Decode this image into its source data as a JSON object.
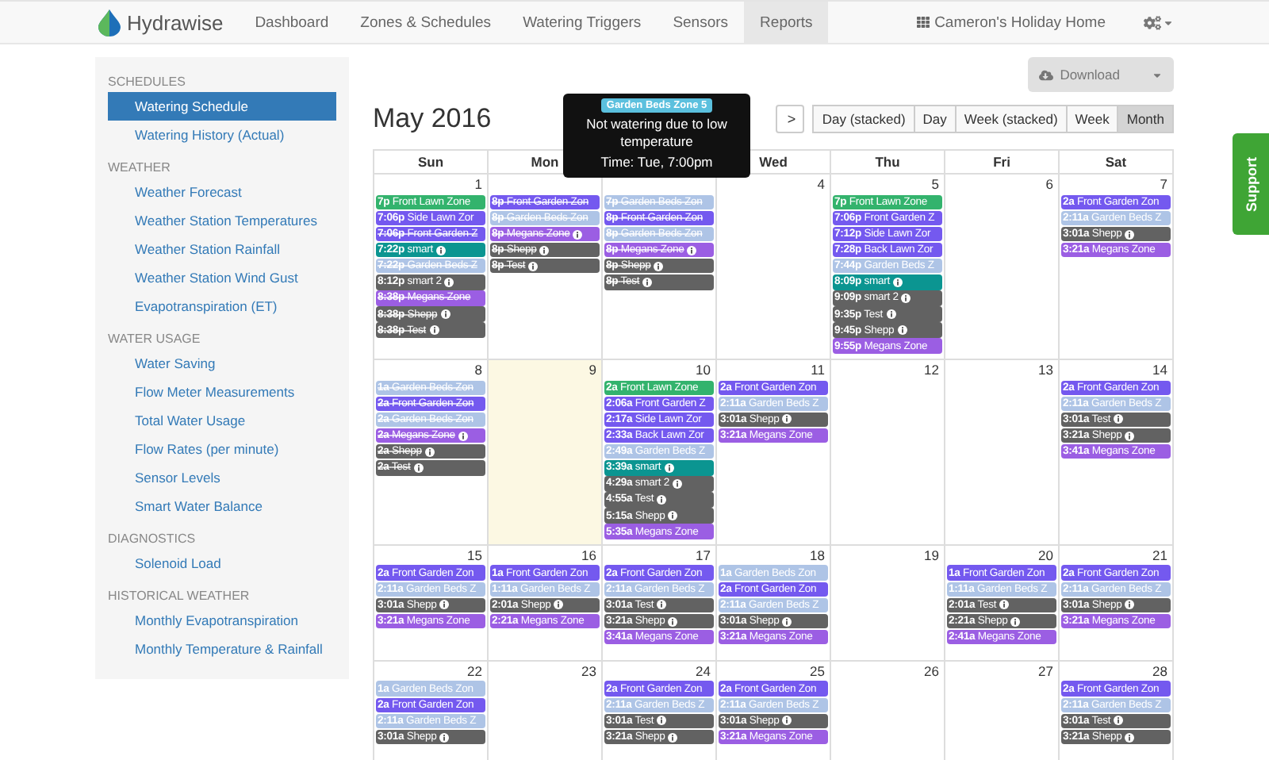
{
  "app": {
    "brand": "Hydrawise",
    "account": "Cameron's Holiday Home",
    "nav": [
      {
        "label": "Dashboard",
        "selected": false
      },
      {
        "label": "Zones & Schedules",
        "selected": false
      },
      {
        "label": "Watering Triggers",
        "selected": false
      },
      {
        "label": "Sensors",
        "selected": false
      },
      {
        "label": "Reports",
        "selected": true
      }
    ]
  },
  "sidebar": {
    "sections": [
      {
        "heading": "SCHEDULES",
        "items": [
          {
            "label": "Watering Schedule",
            "selected": true
          },
          {
            "label": "Watering History (Actual)",
            "selected": false
          }
        ]
      },
      {
        "heading": "WEATHER",
        "items": [
          {
            "label": "Weather Forecast",
            "selected": false
          },
          {
            "label": "Weather Station Temperatures",
            "selected": false
          },
          {
            "label": "Weather Station Rainfall",
            "selected": false
          },
          {
            "label": "Weather Station Wind Gust",
            "selected": false
          },
          {
            "label": "Evapotranspiration (ET)",
            "selected": false
          }
        ]
      },
      {
        "heading": "WATER USAGE",
        "items": [
          {
            "label": "Water Saving",
            "selected": false
          },
          {
            "label": "Flow Meter Measurements",
            "selected": false
          },
          {
            "label": "Total Water Usage",
            "selected": false
          },
          {
            "label": "Flow Rates (per minute)",
            "selected": false
          },
          {
            "label": "Sensor Levels",
            "selected": false
          },
          {
            "label": "Smart Water Balance",
            "selected": false
          }
        ]
      },
      {
        "heading": "DIAGNOSTICS",
        "items": [
          {
            "label": "Solenoid Load",
            "selected": false
          }
        ]
      },
      {
        "heading": "HISTORICAL WEATHER",
        "items": [
          {
            "label": "Monthly Evapotranspiration",
            "selected": false
          },
          {
            "label": "Monthly Temperature & Rainfall",
            "selected": false
          }
        ]
      }
    ]
  },
  "toolbar": {
    "download": "Download",
    "title": "May 2016",
    "next": ">",
    "views": [
      {
        "label": "Day (stacked)",
        "selected": false
      },
      {
        "label": "Day",
        "selected": false
      },
      {
        "label": "Week (stacked)",
        "selected": false
      },
      {
        "label": "Week",
        "selected": false
      },
      {
        "label": "Month",
        "selected": true
      }
    ]
  },
  "tooltip": {
    "badge": "Garden Beds Zone 5",
    "message": "Not watering due to low temperature",
    "time": "Time: Tue, 7:00pm"
  },
  "support": "Support",
  "calendar": {
    "weekdays": [
      "Sun",
      "Mon",
      "Wed",
      "Thu",
      "Fri",
      "Sat"
    ],
    "weeks": [
      {
        "days": [
          {
            "number": "1",
            "today": false,
            "events": [
              {
                "time": "7p",
                "zone": "Front Lawn Zone",
                "color": "#33b36d",
                "struck": false,
                "info": false
              },
              {
                "time": "7:06p",
                "zone": "Side Lawn Zor",
                "color": "#7459ef",
                "struck": false,
                "info": false
              },
              {
                "time": "7:06p",
                "zone": "Front Garden Z",
                "color": "#7459ef",
                "struck": true,
                "info": false
              },
              {
                "time": "7:22p",
                "zone": "smart",
                "color": "#0b9591",
                "struck": false,
                "info": true
              },
              {
                "time": "7:22p",
                "zone": "Garden Beds Z",
                "color": "#aec4e6",
                "struck": true,
                "info": false
              },
              {
                "time": "8:12p",
                "zone": "smart 2",
                "color": "#626262",
                "struck": false,
                "info": true
              },
              {
                "time": "8:38p",
                "zone": "Megans Zone",
                "color": "#9b5ee3",
                "struck": true,
                "info": false
              },
              {
                "time": "8:38p",
                "zone": "Shepp",
                "color": "#626262",
                "struck": true,
                "info": true
              },
              {
                "time": "8:38p",
                "zone": "Test",
                "color": "#626262",
                "struck": true,
                "info": true
              }
            ]
          },
          {
            "today": false,
            "events": [
              {
                "time": "8p",
                "zone": "Front Garden Zon",
                "color": "#7459ef",
                "struck": true,
                "info": false
              },
              {
                "time": "8p",
                "zone": "Garden Beds Zon",
                "color": "#aec4e6",
                "struck": true,
                "info": false
              },
              {
                "time": "8p",
                "zone": "Megans Zone",
                "color": "#9b5ee3",
                "struck": true,
                "info": true
              },
              {
                "time": "8p",
                "zone": "Shepp",
                "color": "#626262",
                "struck": true,
                "info": true
              },
              {
                "time": "8p",
                "zone": "Test",
                "color": "#626262",
                "struck": true,
                "info": true
              }
            ]
          },
          {
            "today": false,
            "events": [
              {
                "time": "7p",
                "zone": "Garden Beds Zon",
                "color": "#aec4e6",
                "struck": true,
                "info": false
              },
              {
                "time": "8p",
                "zone": "Front Garden Zon",
                "color": "#7459ef",
                "struck": true,
                "info": false
              },
              {
                "time": "8p",
                "zone": "Garden Beds Zon",
                "color": "#aec4e6",
                "struck": true,
                "info": false
              },
              {
                "time": "8p",
                "zone": "Megans Zone",
                "color": "#9b5ee3",
                "struck": true,
                "info": true
              },
              {
                "time": "8p",
                "zone": "Shepp",
                "color": "#626262",
                "struck": true,
                "info": true
              },
              {
                "time": "8p",
                "zone": "Test",
                "color": "#626262",
                "struck": true,
                "info": true
              }
            ]
          },
          {
            "number": "4",
            "today": false
          },
          {
            "number": "5",
            "today": false,
            "events": [
              {
                "time": "7p",
                "zone": "Front Lawn Zone",
                "color": "#33b36d",
                "struck": false,
                "info": false
              },
              {
                "time": "7:06p",
                "zone": "Front Garden Z",
                "color": "#7459ef",
                "struck": false,
                "info": false
              },
              {
                "time": "7:12p",
                "zone": "Side Lawn Zor",
                "color": "#7459ef",
                "struck": false,
                "info": false
              },
              {
                "time": "7:28p",
                "zone": "Back Lawn Zor",
                "color": "#7459ef",
                "struck": false,
                "info": false
              },
              {
                "time": "7:44p",
                "zone": "Garden Beds Z",
                "color": "#aec4e6",
                "struck": false,
                "info": false
              },
              {
                "time": "8:09p",
                "zone": "smart",
                "color": "#0b9591",
                "struck": false,
                "info": true
              },
              {
                "time": "9:09p",
                "zone": "smart 2",
                "color": "#626262",
                "struck": false,
                "info": true
              },
              {
                "time": "9:35p",
                "zone": "Test",
                "color": "#626262",
                "struck": false,
                "info": true
              },
              {
                "time": "9:45p",
                "zone": "Shepp",
                "color": "#626262",
                "struck": false,
                "info": true
              },
              {
                "time": "9:55p",
                "zone": "Megans Zone",
                "color": "#9b5ee3",
                "struck": false,
                "info": false
              }
            ]
          },
          {
            "number": "6",
            "today": false
          },
          {
            "number": "7",
            "today": false,
            "events": [
              {
                "time": "2a",
                "zone": "Front Garden Zon",
                "color": "#7459ef",
                "struck": false,
                "info": false
              },
              {
                "time": "2:11a",
                "zone": "Garden Beds Z",
                "color": "#aec4e6",
                "struck": false,
                "info": false
              },
              {
                "time": "3:01a",
                "zone": "Shepp",
                "color": "#626262",
                "struck": false,
                "info": true
              },
              {
                "time": "3:21a",
                "zone": "Megans Zone",
                "color": "#9b5ee3",
                "struck": false,
                "info": false
              }
            ]
          }
        ]
      },
      {
        "days": [
          {
            "number": "8",
            "today": false,
            "events": [
              {
                "time": "1a",
                "zone": "Garden Beds Zon",
                "color": "#aec4e6",
                "struck": true,
                "info": false
              },
              {
                "time": "2a",
                "zone": "Front Garden Zon",
                "color": "#7459ef",
                "struck": true,
                "info": false
              },
              {
                "time": "2a",
                "zone": "Garden Beds Zon",
                "color": "#aec4e6",
                "struck": true,
                "info": false
              },
              {
                "time": "2a",
                "zone": "Megans Zone",
                "color": "#9b5ee3",
                "struck": true,
                "info": true
              },
              {
                "time": "2a",
                "zone": "Shepp",
                "color": "#626262",
                "struck": true,
                "info": true
              },
              {
                "time": "2a",
                "zone": "Test",
                "color": "#626262",
                "struck": true,
                "info": true
              }
            ]
          },
          {
            "number": "9",
            "today": true
          },
          {
            "number": "10",
            "today": false,
            "events": [
              {
                "time": "2a",
                "zone": "Front Lawn Zone",
                "color": "#33b36d",
                "struck": false,
                "info": false
              },
              {
                "time": "2:06a",
                "zone": "Front Garden Z",
                "color": "#7459ef",
                "struck": false,
                "info": false
              },
              {
                "time": "2:17a",
                "zone": "Side Lawn Zor",
                "color": "#7459ef",
                "struck": false,
                "info": false
              },
              {
                "time": "2:33a",
                "zone": "Back Lawn Zor",
                "color": "#7459ef",
                "struck": false,
                "info": false
              },
              {
                "time": "2:49a",
                "zone": "Garden Beds Z",
                "color": "#aec4e6",
                "struck": false,
                "info": false
              },
              {
                "time": "3:39a",
                "zone": "smart",
                "color": "#0b9591",
                "struck": false,
                "info": true
              },
              {
                "time": "4:29a",
                "zone": "smart 2",
                "color": "#626262",
                "struck": false,
                "info": true
              },
              {
                "time": "4:55a",
                "zone": "Test",
                "color": "#626262",
                "struck": false,
                "info": true
              },
              {
                "time": "5:15a",
                "zone": "Shepp",
                "color": "#626262",
                "struck": false,
                "info": true
              },
              {
                "time": "5:35a",
                "zone": "Megans Zone",
                "color": "#9b5ee3",
                "struck": false,
                "info": false
              }
            ]
          },
          {
            "number": "11",
            "today": false,
            "events": [
              {
                "time": "2a",
                "zone": "Front Garden Zon",
                "color": "#7459ef",
                "struck": false,
                "info": false
              },
              {
                "time": "2:11a",
                "zone": "Garden Beds Z",
                "color": "#aec4e6",
                "struck": false,
                "info": false
              },
              {
                "time": "3:01a",
                "zone": "Shepp",
                "color": "#626262",
                "struck": false,
                "info": true
              },
              {
                "time": "3:21a",
                "zone": "Megans Zone",
                "color": "#9b5ee3",
                "struck": false,
                "info": false
              }
            ]
          },
          {
            "number": "12",
            "today": false
          },
          {
            "number": "13",
            "today": false
          },
          {
            "number": "14",
            "today": false,
            "events": [
              {
                "time": "2a",
                "zone": "Front Garden Zon",
                "color": "#7459ef",
                "struck": false,
                "info": false
              },
              {
                "time": "2:11a",
                "zone": "Garden Beds Z",
                "color": "#aec4e6",
                "struck": false,
                "info": false
              },
              {
                "time": "3:01a",
                "zone": "Test",
                "color": "#626262",
                "struck": false,
                "info": true
              },
              {
                "time": "3:21a",
                "zone": "Shepp",
                "color": "#626262",
                "struck": false,
                "info": true
              },
              {
                "time": "3:41a",
                "zone": "Megans Zone",
                "color": "#9b5ee3",
                "struck": false,
                "info": false
              }
            ]
          }
        ]
      },
      {
        "days": [
          {
            "number": "15",
            "today": false,
            "events": [
              {
                "time": "2a",
                "zone": "Front Garden Zon",
                "color": "#7459ef",
                "struck": false,
                "info": false
              },
              {
                "time": "2:11a",
                "zone": "Garden Beds Z",
                "color": "#aec4e6",
                "struck": false,
                "info": false
              },
              {
                "time": "3:01a",
                "zone": "Shepp",
                "color": "#626262",
                "struck": false,
                "info": true
              },
              {
                "time": "3:21a",
                "zone": "Megans Zone",
                "color": "#9b5ee3",
                "struck": false,
                "info": false
              }
            ]
          },
          {
            "number": "16",
            "today": false,
            "events": [
              {
                "time": "1a",
                "zone": "Front Garden Zon",
                "color": "#7459ef",
                "struck": false,
                "info": false
              },
              {
                "time": "1:11a",
                "zone": "Garden Beds Z",
                "color": "#aec4e6",
                "struck": false,
                "info": false
              },
              {
                "time": "2:01a",
                "zone": "Shepp",
                "color": "#626262",
                "struck": false,
                "info": true
              },
              {
                "time": "2:21a",
                "zone": "Megans Zone",
                "color": "#9b5ee3",
                "struck": false,
                "info": false
              }
            ]
          },
          {
            "number": "17",
            "today": false,
            "events": [
              {
                "time": "2a",
                "zone": "Front Garden Zon",
                "color": "#7459ef",
                "struck": false,
                "info": false
              },
              {
                "time": "2:11a",
                "zone": "Garden Beds Z",
                "color": "#aec4e6",
                "struck": false,
                "info": false
              },
              {
                "time": "3:01a",
                "zone": "Test",
                "color": "#626262",
                "struck": false,
                "info": true
              },
              {
                "time": "3:21a",
                "zone": "Shepp",
                "color": "#626262",
                "struck": false,
                "info": true
              },
              {
                "time": "3:41a",
                "zone": "Megans Zone",
                "color": "#9b5ee3",
                "struck": false,
                "info": false
              }
            ]
          },
          {
            "number": "18",
            "today": false,
            "events": [
              {
                "time": "1a",
                "zone": "Garden Beds Zon",
                "color": "#aec4e6",
                "struck": false,
                "info": false
              },
              {
                "time": "2a",
                "zone": "Front Garden Zon",
                "color": "#7459ef",
                "struck": false,
                "info": false
              },
              {
                "time": "2:11a",
                "zone": "Garden Beds Z",
                "color": "#aec4e6",
                "struck": false,
                "info": false
              },
              {
                "time": "3:01a",
                "zone": "Shepp",
                "color": "#626262",
                "struck": false,
                "info": true
              },
              {
                "time": "3:21a",
                "zone": "Megans Zone",
                "color": "#9b5ee3",
                "struck": false,
                "info": false
              }
            ]
          },
          {
            "number": "19",
            "today": false
          },
          {
            "number": "20",
            "today": false,
            "events": [
              {
                "time": "1a",
                "zone": "Front Garden Zon",
                "color": "#7459ef",
                "struck": false,
                "info": false
              },
              {
                "time": "1:11a",
                "zone": "Garden Beds Z",
                "color": "#aec4e6",
                "struck": false,
                "info": false
              },
              {
                "time": "2:01a",
                "zone": "Test",
                "color": "#626262",
                "struck": false,
                "info": true
              },
              {
                "time": "2:21a",
                "zone": "Shepp",
                "color": "#626262",
                "struck": false,
                "info": true
              },
              {
                "time": "2:41a",
                "zone": "Megans Zone",
                "color": "#9b5ee3",
                "struck": false,
                "info": false
              }
            ]
          },
          {
            "number": "21",
            "today": false,
            "events": [
              {
                "time": "2a",
                "zone": "Front Garden Zon",
                "color": "#7459ef",
                "struck": false,
                "info": false
              },
              {
                "time": "2:11a",
                "zone": "Garden Beds Z",
                "color": "#aec4e6",
                "struck": false,
                "info": false
              },
              {
                "time": "3:01a",
                "zone": "Shepp",
                "color": "#626262",
                "struck": false,
                "info": true
              },
              {
                "time": "3:21a",
                "zone": "Megans Zone",
                "color": "#9b5ee3",
                "struck": false,
                "info": false
              }
            ]
          }
        ]
      },
      {
        "days": [
          {
            "number": "22",
            "today": false,
            "events": [
              {
                "time": "1a",
                "zone": "Garden Beds Zon",
                "color": "#aec4e6",
                "struck": false,
                "info": false
              },
              {
                "time": "2a",
                "zone": "Front Garden Zon",
                "color": "#7459ef",
                "struck": false,
                "info": false
              },
              {
                "time": "2:11a",
                "zone": "Garden Beds Z",
                "color": "#aec4e6",
                "struck": false,
                "info": false
              },
              {
                "time": "3:01a",
                "zone": "Shepp",
                "color": "#626262",
                "struck": false,
                "info": true
              }
            ]
          },
          {
            "number": "23",
            "today": false
          },
          {
            "number": "24",
            "today": false,
            "events": [
              {
                "time": "2a",
                "zone": "Front Garden Zon",
                "color": "#7459ef",
                "struck": false,
                "info": false
              },
              {
                "time": "2:11a",
                "zone": "Garden Beds Z",
                "color": "#aec4e6",
                "struck": false,
                "info": false
              },
              {
                "time": "3:01a",
                "zone": "Test",
                "color": "#626262",
                "struck": false,
                "info": true
              },
              {
                "time": "3:21a",
                "zone": "Shepp",
                "color": "#626262",
                "struck": false,
                "info": true
              }
            ]
          },
          {
            "number": "25",
            "today": false,
            "events": [
              {
                "time": "2a",
                "zone": "Front Garden Zon",
                "color": "#7459ef",
                "struck": false,
                "info": false
              },
              {
                "time": "2:11a",
                "zone": "Garden Beds Z",
                "color": "#aec4e6",
                "struck": false,
                "info": false
              },
              {
                "time": "3:01a",
                "zone": "Shepp",
                "color": "#626262",
                "struck": false,
                "info": true
              },
              {
                "time": "3:21a",
                "zone": "Megans Zone",
                "color": "#9b5ee3",
                "struck": false,
                "info": false
              }
            ]
          },
          {
            "number": "26",
            "today": false
          },
          {
            "number": "27",
            "today": false
          },
          {
            "number": "28",
            "today": false,
            "events": [
              {
                "time": "2a",
                "zone": "Front Garden Zon",
                "color": "#7459ef",
                "struck": false,
                "info": false
              },
              {
                "time": "2:11a",
                "zone": "Garden Beds Z",
                "color": "#aec4e6",
                "struck": false,
                "info": false
              },
              {
                "time": "3:01a",
                "zone": "Test",
                "color": "#626262",
                "struck": false,
                "info": true
              },
              {
                "time": "3:21a",
                "zone": "Shepp",
                "color": "#626262",
                "struck": false,
                "info": true
              }
            ]
          }
        ]
      }
    ]
  }
}
